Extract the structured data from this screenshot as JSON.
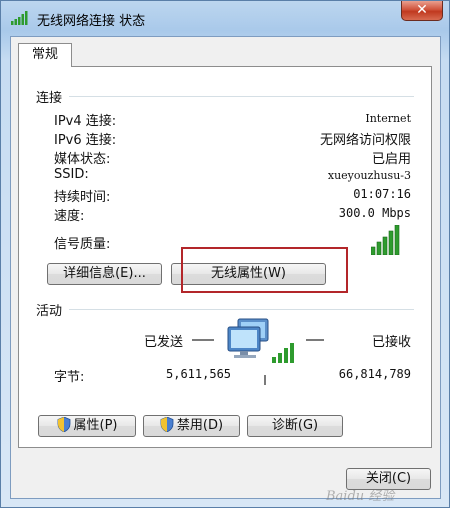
{
  "window": {
    "title": "无线网络连接 状态",
    "close_label": "✕"
  },
  "tabs": [
    {
      "label": "常规"
    }
  ],
  "connection": {
    "section_label": "连接",
    "rows": [
      {
        "label": "IPv4 连接:",
        "value": "Internet"
      },
      {
        "label": "IPv6 连接:",
        "value": "无网络访问权限"
      },
      {
        "label": "媒体状态:",
        "value": "已启用"
      },
      {
        "label": "SSID:",
        "value": "xueyouzhusu-3"
      },
      {
        "label": "持续时间:",
        "value": "01:07:16"
      },
      {
        "label": "速度:",
        "value": "300.0 Mbps"
      }
    ],
    "signal_label": "信号质量:",
    "signal_bars_filled": 5,
    "signal_bars_total": 5,
    "details_button": "详细信息(E)...",
    "wireless_props_button": "无线属性(W)"
  },
  "activity": {
    "section_label": "活动",
    "sent_label": "已发送",
    "received_label": "已接收",
    "bytes_label": "字节:",
    "sent_value": "5,611,565",
    "received_value": "66,814,789"
  },
  "actions": {
    "properties_button": "属性(P)",
    "disable_button": "禁用(D)",
    "diagnose_button": "诊断(G)"
  },
  "footer": {
    "close_button": "关闭(C)"
  },
  "watermark_text": "Baidu 经验",
  "colors": {
    "highlight": "#b3262a",
    "signal": "#2e9b2e"
  }
}
